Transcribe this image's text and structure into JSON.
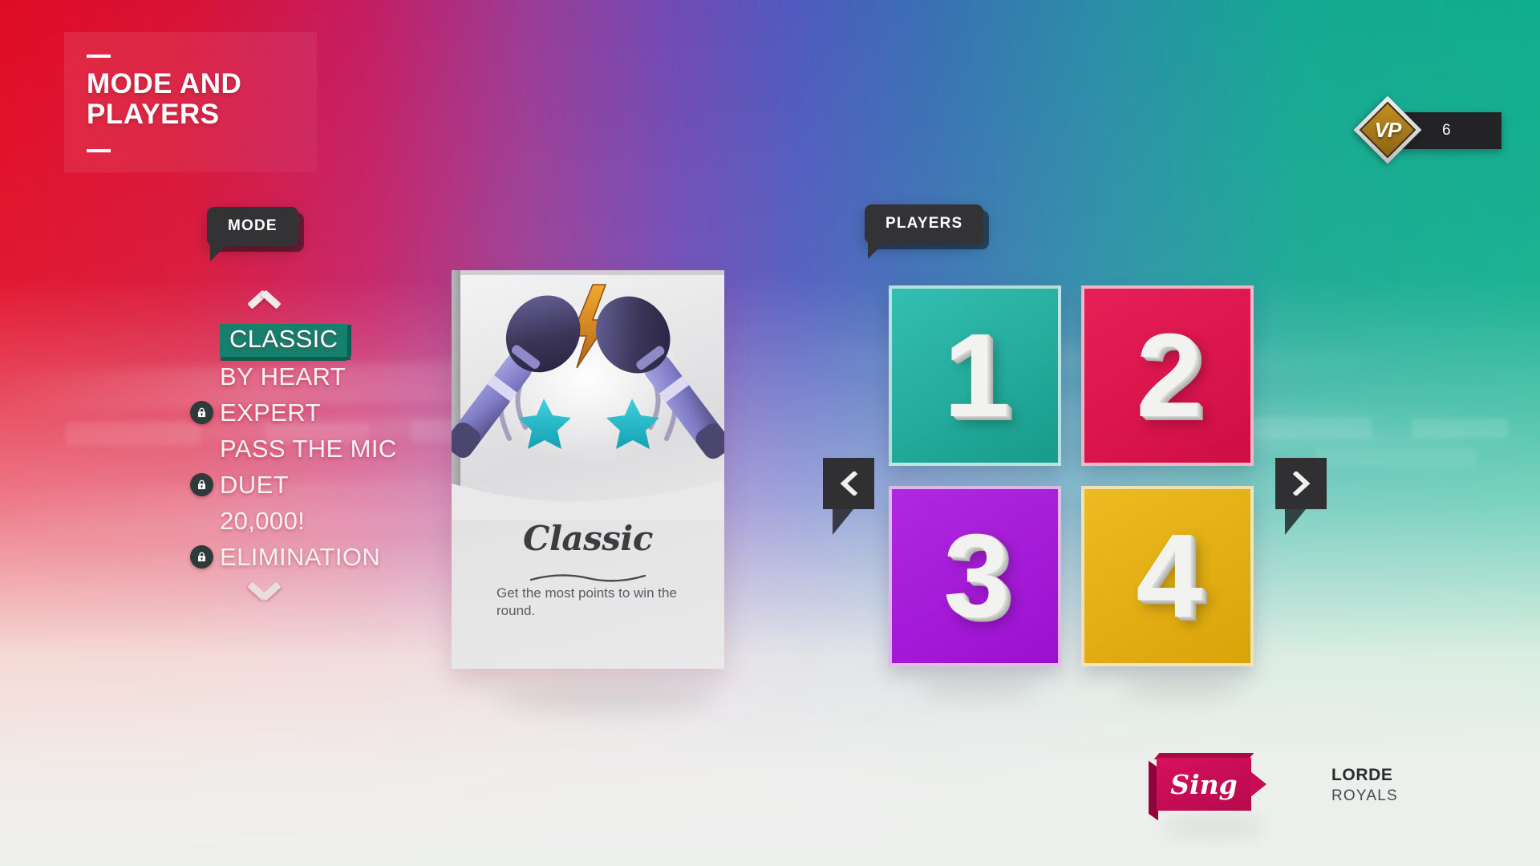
{
  "screen": {
    "title": "MODE AND\nPLAYERS",
    "background_colors": {
      "left": "#e00c26",
      "mid_left": "#c41e63",
      "mid": "#4f5bbe",
      "right": "#0fae8c",
      "bottom_fade": "#eef0ee"
    }
  },
  "mode_section": {
    "bubble_label": "MODE",
    "scroll_up_icon": "chevron-up-icon",
    "scroll_down_icon": "chevron-down-icon",
    "selected_index": 0,
    "highlight_color": "#16806e",
    "items": [
      {
        "label": "CLASSIC",
        "locked": false,
        "selected": true
      },
      {
        "label": "BY HEART",
        "locked": false,
        "selected": false
      },
      {
        "label": "EXPERT",
        "locked": true,
        "selected": false
      },
      {
        "label": "PASS THE MIC",
        "locked": false,
        "selected": false
      },
      {
        "label": "DUET",
        "locked": true,
        "selected": false
      },
      {
        "label": "20,000!",
        "locked": false,
        "selected": false
      },
      {
        "label": "ELIMINATION",
        "locked": true,
        "selected": false
      }
    ]
  },
  "mode_card": {
    "title": "Classic",
    "description": "Get the most points to win the round.",
    "art_icon": "crossed-microphones-icon",
    "art_accent_colors": {
      "mic": "#7d79c6",
      "bolt": "#e08a1e",
      "star": "#18b6c4"
    }
  },
  "players_section": {
    "bubble_label": "PLAYERS",
    "prev_icon": "chevron-left-icon",
    "next_icon": "chevron-right-icon",
    "tiles": [
      {
        "number": "1",
        "color": "#23ada0"
      },
      {
        "number": "2",
        "color": "#e0134d"
      },
      {
        "number": "3",
        "color": "#a81cd8"
      },
      {
        "number": "4",
        "color": "#e3af16"
      }
    ]
  },
  "vp_badge": {
    "label": "VP",
    "value": "6",
    "icon": "vp-diamond-icon"
  },
  "footer": {
    "sing_label": "Sing",
    "artist": "LORDE",
    "song": "ROYALS"
  }
}
